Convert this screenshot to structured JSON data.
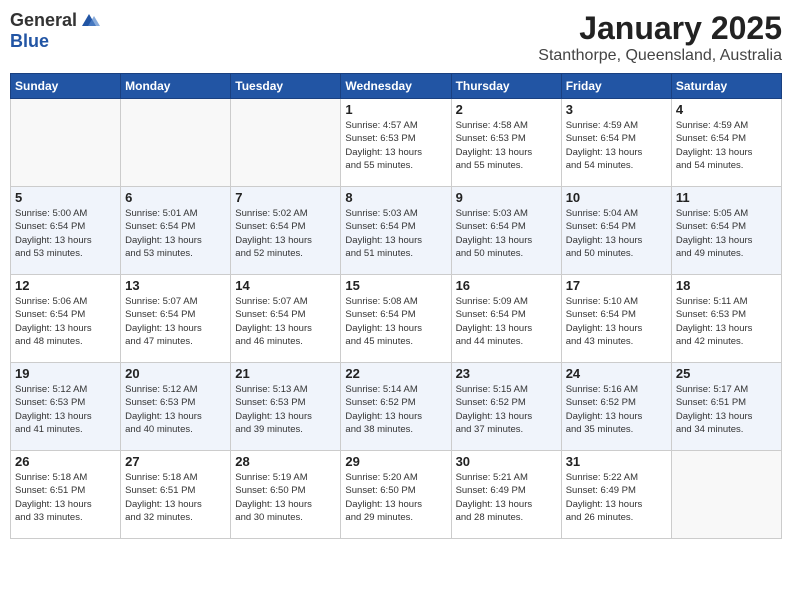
{
  "header": {
    "logo_general": "General",
    "logo_blue": "Blue",
    "month": "January 2025",
    "location": "Stanthorpe, Queensland, Australia"
  },
  "days_of_week": [
    "Sunday",
    "Monday",
    "Tuesday",
    "Wednesday",
    "Thursday",
    "Friday",
    "Saturday"
  ],
  "weeks": [
    [
      {
        "day": "",
        "info": ""
      },
      {
        "day": "",
        "info": ""
      },
      {
        "day": "",
        "info": ""
      },
      {
        "day": "1",
        "info": "Sunrise: 4:57 AM\nSunset: 6:53 PM\nDaylight: 13 hours\nand 55 minutes."
      },
      {
        "day": "2",
        "info": "Sunrise: 4:58 AM\nSunset: 6:53 PM\nDaylight: 13 hours\nand 55 minutes."
      },
      {
        "day": "3",
        "info": "Sunrise: 4:59 AM\nSunset: 6:54 PM\nDaylight: 13 hours\nand 54 minutes."
      },
      {
        "day": "4",
        "info": "Sunrise: 4:59 AM\nSunset: 6:54 PM\nDaylight: 13 hours\nand 54 minutes."
      }
    ],
    [
      {
        "day": "5",
        "info": "Sunrise: 5:00 AM\nSunset: 6:54 PM\nDaylight: 13 hours\nand 53 minutes."
      },
      {
        "day": "6",
        "info": "Sunrise: 5:01 AM\nSunset: 6:54 PM\nDaylight: 13 hours\nand 53 minutes."
      },
      {
        "day": "7",
        "info": "Sunrise: 5:02 AM\nSunset: 6:54 PM\nDaylight: 13 hours\nand 52 minutes."
      },
      {
        "day": "8",
        "info": "Sunrise: 5:03 AM\nSunset: 6:54 PM\nDaylight: 13 hours\nand 51 minutes."
      },
      {
        "day": "9",
        "info": "Sunrise: 5:03 AM\nSunset: 6:54 PM\nDaylight: 13 hours\nand 50 minutes."
      },
      {
        "day": "10",
        "info": "Sunrise: 5:04 AM\nSunset: 6:54 PM\nDaylight: 13 hours\nand 50 minutes."
      },
      {
        "day": "11",
        "info": "Sunrise: 5:05 AM\nSunset: 6:54 PM\nDaylight: 13 hours\nand 49 minutes."
      }
    ],
    [
      {
        "day": "12",
        "info": "Sunrise: 5:06 AM\nSunset: 6:54 PM\nDaylight: 13 hours\nand 48 minutes."
      },
      {
        "day": "13",
        "info": "Sunrise: 5:07 AM\nSunset: 6:54 PM\nDaylight: 13 hours\nand 47 minutes."
      },
      {
        "day": "14",
        "info": "Sunrise: 5:07 AM\nSunset: 6:54 PM\nDaylight: 13 hours\nand 46 minutes."
      },
      {
        "day": "15",
        "info": "Sunrise: 5:08 AM\nSunset: 6:54 PM\nDaylight: 13 hours\nand 45 minutes."
      },
      {
        "day": "16",
        "info": "Sunrise: 5:09 AM\nSunset: 6:54 PM\nDaylight: 13 hours\nand 44 minutes."
      },
      {
        "day": "17",
        "info": "Sunrise: 5:10 AM\nSunset: 6:54 PM\nDaylight: 13 hours\nand 43 minutes."
      },
      {
        "day": "18",
        "info": "Sunrise: 5:11 AM\nSunset: 6:53 PM\nDaylight: 13 hours\nand 42 minutes."
      }
    ],
    [
      {
        "day": "19",
        "info": "Sunrise: 5:12 AM\nSunset: 6:53 PM\nDaylight: 13 hours\nand 41 minutes."
      },
      {
        "day": "20",
        "info": "Sunrise: 5:12 AM\nSunset: 6:53 PM\nDaylight: 13 hours\nand 40 minutes."
      },
      {
        "day": "21",
        "info": "Sunrise: 5:13 AM\nSunset: 6:53 PM\nDaylight: 13 hours\nand 39 minutes."
      },
      {
        "day": "22",
        "info": "Sunrise: 5:14 AM\nSunset: 6:52 PM\nDaylight: 13 hours\nand 38 minutes."
      },
      {
        "day": "23",
        "info": "Sunrise: 5:15 AM\nSunset: 6:52 PM\nDaylight: 13 hours\nand 37 minutes."
      },
      {
        "day": "24",
        "info": "Sunrise: 5:16 AM\nSunset: 6:52 PM\nDaylight: 13 hours\nand 35 minutes."
      },
      {
        "day": "25",
        "info": "Sunrise: 5:17 AM\nSunset: 6:51 PM\nDaylight: 13 hours\nand 34 minutes."
      }
    ],
    [
      {
        "day": "26",
        "info": "Sunrise: 5:18 AM\nSunset: 6:51 PM\nDaylight: 13 hours\nand 33 minutes."
      },
      {
        "day": "27",
        "info": "Sunrise: 5:18 AM\nSunset: 6:51 PM\nDaylight: 13 hours\nand 32 minutes."
      },
      {
        "day": "28",
        "info": "Sunrise: 5:19 AM\nSunset: 6:50 PM\nDaylight: 13 hours\nand 30 minutes."
      },
      {
        "day": "29",
        "info": "Sunrise: 5:20 AM\nSunset: 6:50 PM\nDaylight: 13 hours\nand 29 minutes."
      },
      {
        "day": "30",
        "info": "Sunrise: 5:21 AM\nSunset: 6:49 PM\nDaylight: 13 hours\nand 28 minutes."
      },
      {
        "day": "31",
        "info": "Sunrise: 5:22 AM\nSunset: 6:49 PM\nDaylight: 13 hours\nand 26 minutes."
      },
      {
        "day": "",
        "info": ""
      }
    ]
  ]
}
